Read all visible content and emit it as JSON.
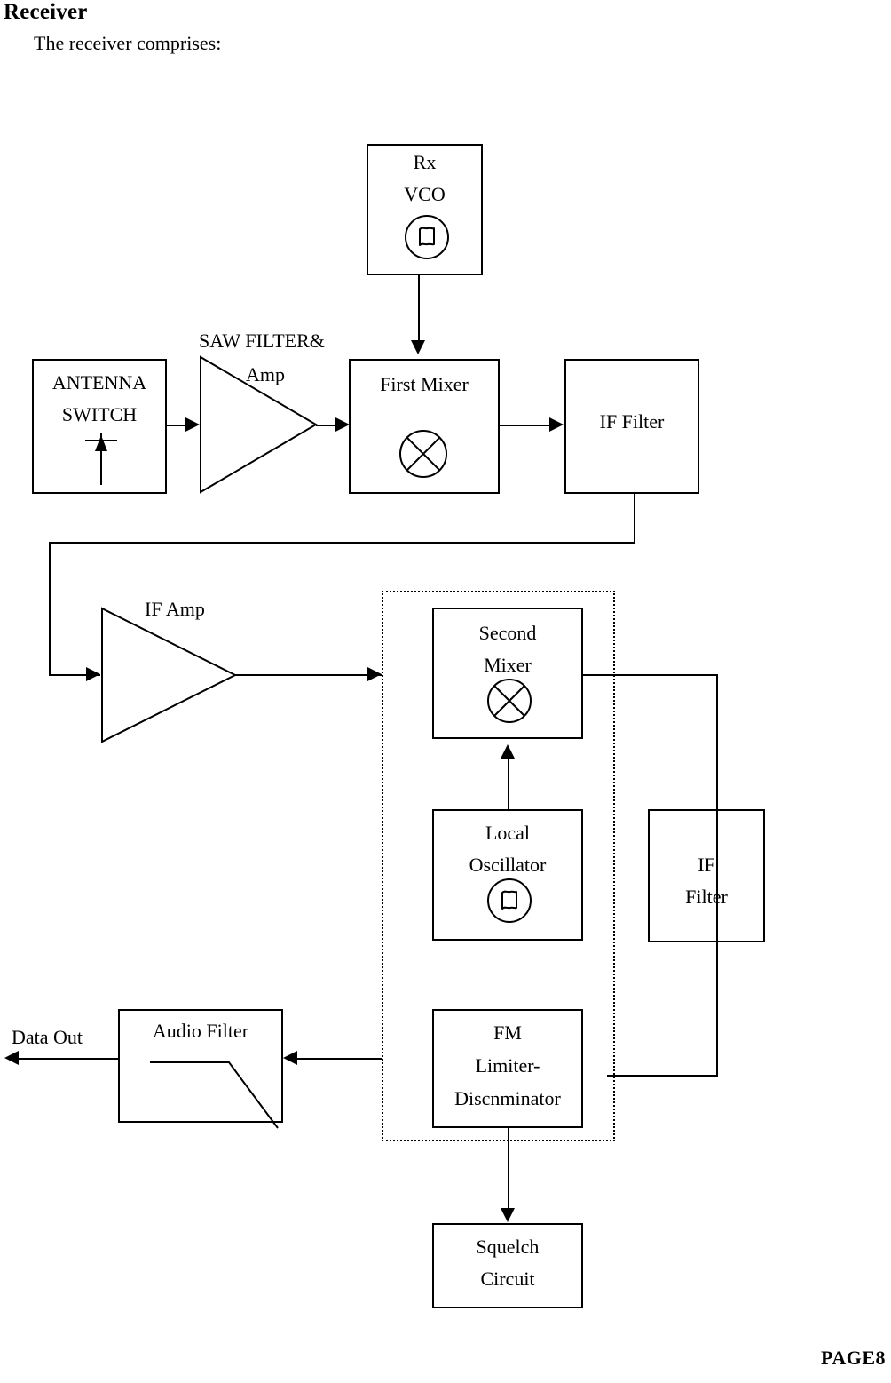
{
  "document": {
    "heading": "Receiver",
    "intro": "The receiver comprises:",
    "footer": "PAGE8"
  },
  "diagram": {
    "type": "block-diagram",
    "title": "Receiver block diagram",
    "blocks": [
      {
        "id": "antenna-switch",
        "label_lines": [
          "ANTENNA",
          "SWITCH"
        ],
        "symbol": "antenna-icon"
      },
      {
        "id": "saw-filter-amp",
        "label_lines": [
          "SAW FILTER&",
          "Amp"
        ],
        "symbol": "amplifier-triangle-icon"
      },
      {
        "id": "first-mixer",
        "label_lines": [
          "First Mixer"
        ],
        "symbol": "mixer-circle-x-icon"
      },
      {
        "id": "if-filter-1",
        "label_lines": [
          "IF    Filter"
        ],
        "symbol": "none"
      },
      {
        "id": "rx-vco",
        "label_lines": [
          "Rx",
          "VCO"
        ],
        "symbol": "oscillator-icon"
      },
      {
        "id": "if-amp",
        "label_lines": [
          "IF Amp"
        ],
        "symbol": "amplifier-triangle-icon"
      },
      {
        "id": "second-mixer",
        "label_lines": [
          "Second",
          "Mixer"
        ],
        "symbol": "mixer-circle-x-icon"
      },
      {
        "id": "local-oscillator",
        "label_lines": [
          "Local",
          "Oscillator"
        ],
        "symbol": "oscillator-icon"
      },
      {
        "id": "if-filter-2",
        "label_lines": [
          "IF",
          "Filter"
        ],
        "symbol": "none"
      },
      {
        "id": "fm-limiter-discriminator",
        "label_lines": [
          "FM",
          "Limiter-",
          "Discnminator"
        ],
        "symbol": "none"
      },
      {
        "id": "audio-filter",
        "label_lines": [
          "Audio Filter"
        ],
        "symbol": "lowpass-filter-icon"
      },
      {
        "id": "squelch-circuit",
        "label_lines": [
          "Squelch",
          "Circuit"
        ],
        "symbol": "none"
      }
    ],
    "labels": {
      "antenna_switch_line1": "ANTENNA",
      "antenna_switch_line2": "SWITCH",
      "saw_filter_line1": "SAW FILTER&",
      "saw_filter_line2": "Amp",
      "first_mixer": "First Mixer",
      "if_filter_1": "IF    Filter",
      "rx_vco_line1": "Rx",
      "rx_vco_line2": "VCO",
      "if_amp": "IF Amp",
      "second_mixer_line1": "Second",
      "second_mixer_line2": "Mixer",
      "local_oscillator_line1": "Local",
      "local_oscillator_line2": "Oscillator",
      "if_filter_2_line1": "IF",
      "if_filter_2_line2": "Filter",
      "fm_line1": "FM",
      "fm_line2": "Limiter-",
      "fm_line3": "Discnminator",
      "audio_filter": "Audio Filter",
      "squelch_line1": "Squelch",
      "squelch_line2": "Circuit",
      "data_out": "Data Out"
    },
    "colors": {
      "stroke": "#000000",
      "background": "#ffffff"
    }
  }
}
